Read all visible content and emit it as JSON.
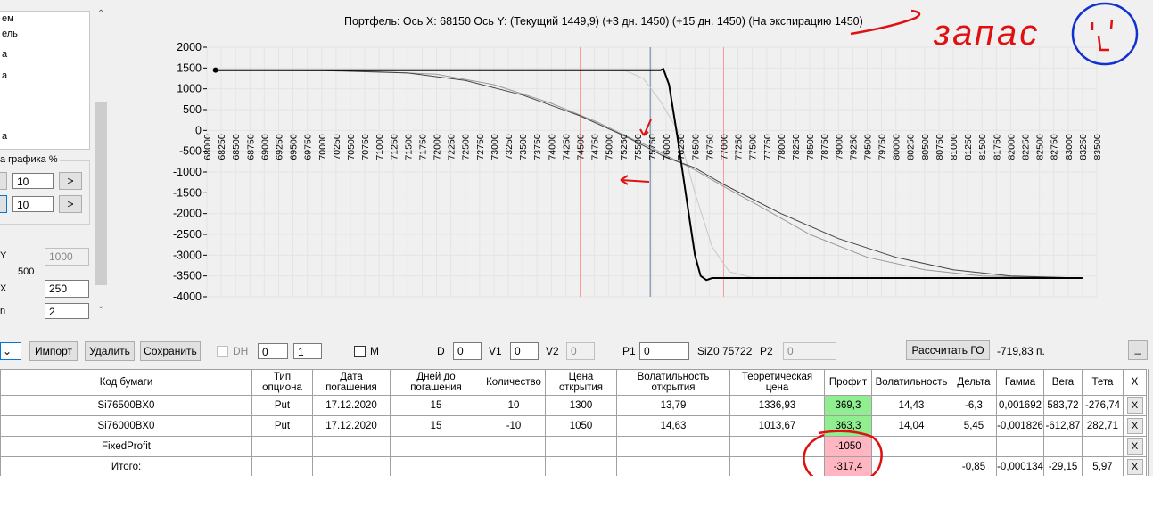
{
  "left_panel": {
    "list_items": [
      "ем",
      "ель",
      "а",
      "а",
      "",
      "",
      "а"
    ],
    "scale_label": "а графика %",
    "scale_row1_value": "10",
    "scale_row2_value": "10",
    "next_label": ">",
    "y_label": "Y",
    "y_value": "1000",
    "y_sub": "500",
    "x_label": "X",
    "x_value": "250",
    "n_label": "n",
    "n_value": "2"
  },
  "chart": {
    "title": "Портфель: Ось X: 68150 Ось Y:  (Текущий 1449,9)  (+3 дн. 1450)  (+15 дн. 1450)  (На экспирацию 1450)",
    "annotation_text": "запас"
  },
  "chart_data": {
    "type": "line",
    "xlim": [
      68000,
      83500
    ],
    "ylim": [
      -4000,
      2000
    ],
    "x_ticks": [
      68000,
      68250,
      68500,
      68750,
      69000,
      69250,
      69500,
      69750,
      70000,
      70250,
      70500,
      70750,
      71000,
      71250,
      71500,
      71750,
      72000,
      72250,
      72500,
      72750,
      73000,
      73250,
      73500,
      73750,
      74000,
      74250,
      74500,
      74750,
      75000,
      75250,
      75500,
      75750,
      76000,
      76250,
      76500,
      76750,
      77000,
      77250,
      77500,
      77750,
      78000,
      78250,
      78500,
      78750,
      79000,
      79250,
      79500,
      79750,
      80000,
      80250,
      80500,
      80750,
      81000,
      81250,
      81500,
      81750,
      82000,
      82250,
      82500,
      82750,
      83000,
      83250,
      83500
    ],
    "y_ticks": [
      2000,
      1500,
      1000,
      500,
      0,
      -500,
      -1000,
      -1500,
      -2000,
      -2500,
      -3000,
      -3500,
      -4000
    ],
    "vertical_markers": [
      {
        "x": 74500,
        "color": "#ff9999"
      },
      {
        "x": 75722,
        "color": "#6080a0"
      },
      {
        "x": 77000,
        "color": "#ff9999"
      }
    ],
    "series": [
      {
        "color": "#000000",
        "width": 2,
        "points": [
          [
            68150,
            1450
          ],
          [
            75900,
            1450
          ],
          [
            75950,
            1480
          ],
          [
            76050,
            1100
          ],
          [
            76200,
            -200
          ],
          [
            76350,
            -1600
          ],
          [
            76500,
            -3000
          ],
          [
            76600,
            -3500
          ],
          [
            76700,
            -3600
          ],
          [
            76800,
            -3550
          ],
          [
            83250,
            -3550
          ]
        ]
      },
      {
        "color": "#444444",
        "width": 1,
        "points": [
          [
            68150,
            1445
          ],
          [
            70000,
            1440
          ],
          [
            71500,
            1380
          ],
          [
            72500,
            1200
          ],
          [
            73500,
            850
          ],
          [
            74500,
            350
          ],
          [
            75300,
            -150
          ],
          [
            75722,
            -450
          ],
          [
            76000,
            -650
          ],
          [
            76500,
            -900
          ],
          [
            77000,
            -1300
          ],
          [
            78000,
            -2000
          ],
          [
            79000,
            -2600
          ],
          [
            80000,
            -3050
          ],
          [
            81000,
            -3350
          ],
          [
            82000,
            -3500
          ],
          [
            83250,
            -3550
          ]
        ]
      },
      {
        "color": "#999999",
        "width": 1,
        "points": [
          [
            68150,
            1448
          ],
          [
            70500,
            1440
          ],
          [
            72000,
            1350
          ],
          [
            73000,
            1100
          ],
          [
            74000,
            650
          ],
          [
            74800,
            200
          ],
          [
            75400,
            -200
          ],
          [
            75722,
            -400
          ],
          [
            76000,
            -600
          ],
          [
            76500,
            -950
          ],
          [
            77000,
            -1350
          ],
          [
            77600,
            -1800
          ],
          [
            78500,
            -2500
          ],
          [
            79500,
            -3050
          ],
          [
            80500,
            -3350
          ],
          [
            81500,
            -3500
          ],
          [
            83250,
            -3550
          ]
        ]
      },
      {
        "color": "#c8c8c8",
        "width": 1,
        "points": [
          [
            68150,
            1450
          ],
          [
            74800,
            1450
          ],
          [
            75300,
            1430
          ],
          [
            75600,
            1250
          ],
          [
            75900,
            700
          ],
          [
            76200,
            0
          ],
          [
            76500,
            -1500
          ],
          [
            76800,
            -2800
          ],
          [
            77100,
            -3400
          ],
          [
            77500,
            -3540
          ],
          [
            83250,
            -3550
          ]
        ]
      }
    ]
  },
  "toolbar": {
    "import_label": "Импорт",
    "delete_label": "Удалить",
    "save_label": "Сохранить",
    "dh_label": "DH",
    "spin1_value": "0",
    "spin2_value": "1",
    "m_label": "M",
    "d_label": "D",
    "d_value": "0",
    "v1_label": "V1",
    "v1_value": "0",
    "v2_label": "V2",
    "v2_value": "0",
    "p1_label": "P1",
    "p1_value": "0",
    "siz_label": "SiZ0 75722",
    "p2_label": "P2",
    "p2_value": "0",
    "calc_go_label": "Рассчитать ГО",
    "go_value": "-719,83 п.",
    "minimize_label": "_"
  },
  "grid": {
    "headers": [
      "Код бумаги",
      "Тип опциона",
      "Дата погашения",
      "Дней до погашения",
      "Количество",
      "Цена открытия",
      "Волатильность открытия",
      "Теоретическая цена",
      "Профит",
      "Волатильность",
      "Дельта",
      "Гамма",
      "Вега",
      "Тета",
      "X"
    ],
    "rows": [
      [
        "Si76500BX0",
        "Put",
        "17.12.2020",
        "15",
        "10",
        "1300",
        "13,79",
        "1336,93",
        "369,3",
        "14,43",
        "-6,3",
        "0,001692",
        "583,72",
        "-276,74",
        "X"
      ],
      [
        "Si76000BX0",
        "Put",
        "17.12.2020",
        "15",
        "-10",
        "1050",
        "14,63",
        "1013,67",
        "363,3",
        "14,04",
        "5,45",
        "-0,001826",
        "-612,87",
        "282,71",
        "X"
      ],
      [
        "FixedProfit",
        "",
        "",
        "",
        "",
        "",
        "",
        "",
        "-1050",
        "",
        "",
        "",
        "",
        "",
        "X"
      ],
      [
        "Итого:",
        "",
        "",
        "",
        "",
        "",
        "",
        "",
        "-317,4",
        "",
        "-0,85",
        "-0,000134",
        "-29,15",
        "5,97",
        "X"
      ]
    ],
    "profit_colors": [
      "#90ee90",
      "#90ee90",
      "#ffb6c1",
      "#ffb6c1"
    ]
  }
}
